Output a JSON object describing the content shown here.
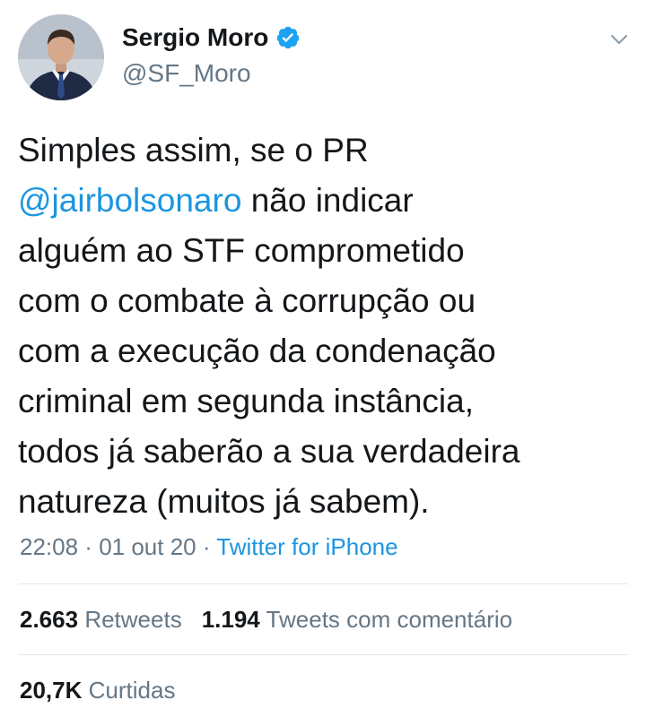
{
  "user": {
    "display_name": "Sergio Moro",
    "handle": "@SF_Moro"
  },
  "tweet": {
    "line1": "Simples assim, se o PR",
    "mention": "@jairbolsonaro",
    "rest": " não indicar\nalguém ao STF comprometido\ncom o combate à corrupção ou\ncom a execução da condenação\ncriminal em segunda instância,\ntodos já saberão a sua verdadeira\nnatureza (muitos já sabem)."
  },
  "meta": {
    "time": "22:08",
    "sep1": " · ",
    "date": "01 out 20",
    "sep2": " · ",
    "source": "Twitter for iPhone"
  },
  "stats": {
    "retweets_count": "2.663",
    "retweets_label": "Retweets",
    "quotes_count": "1.194",
    "quotes_label": "Tweets com comentário",
    "likes_count": "20,7K",
    "likes_label": "Curtidas"
  },
  "colors": {
    "link": "#1b95e0",
    "secondary_text": "#657786",
    "primary_text": "#14171a",
    "divider": "#e1e8ed"
  },
  "icons": {
    "verified": "verified-badge-icon",
    "chevron": "chevron-down-icon"
  }
}
